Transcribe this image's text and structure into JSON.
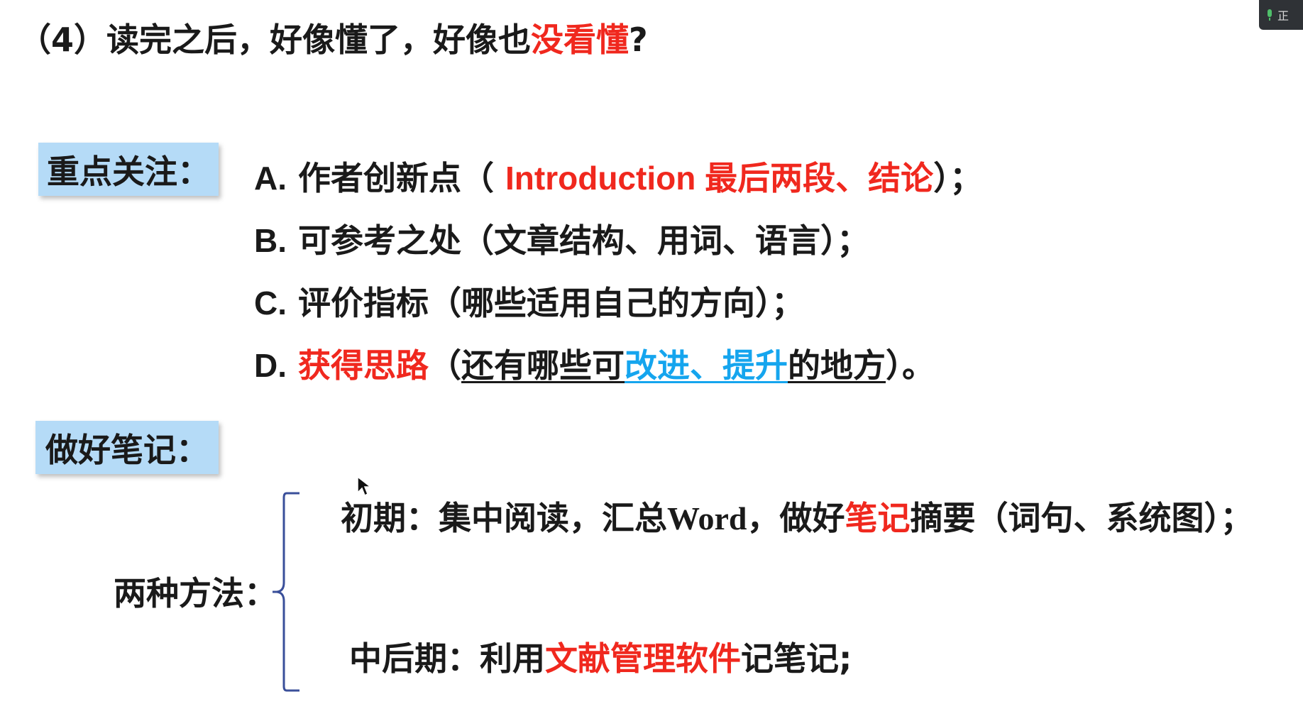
{
  "slide": {
    "title": {
      "prefix": "（4）读完之后，好像懂了，好像也",
      "highlight": "没看懂",
      "suffix": "?"
    },
    "focus": {
      "label": "重点关注：",
      "items": [
        {
          "letter": "A.",
          "text_before": " 作者创新点（ ",
          "highlight": "Introduction 最后两段、结论",
          "text_after": "）；"
        },
        {
          "letter": "B.",
          "text": " 可参考之处（文章结构、用词、语言）；"
        },
        {
          "letter": "C.",
          "text": " 评价指标（哪些适用自己的方向）；"
        },
        {
          "letter": "D.",
          "highlight": " 获得思路",
          "paren_open": "（",
          "underline_part1": "还有哪些可",
          "blue_part": "改进、提升",
          "underline_part2": "的地方",
          "paren_close": "）。"
        }
      ]
    },
    "notes": {
      "label": "做好笔记：",
      "methods_label": "两种方法：",
      "early": {
        "before": "初期：集中阅读，汇总",
        "word": "Word",
        "middle": "，做好",
        "highlight": "笔记",
        "after": "摘要（词句、系统图）；"
      },
      "late": {
        "before": "中后期：利用",
        "highlight": "文献管理软件",
        "after": "记笔记;"
      }
    }
  },
  "colors": {
    "red": "#f0281e",
    "blue": "#15a5ee",
    "label_bg": "#b5dbf7"
  },
  "corner_widget": {
    "icon": "mic-icon",
    "text": "正"
  }
}
